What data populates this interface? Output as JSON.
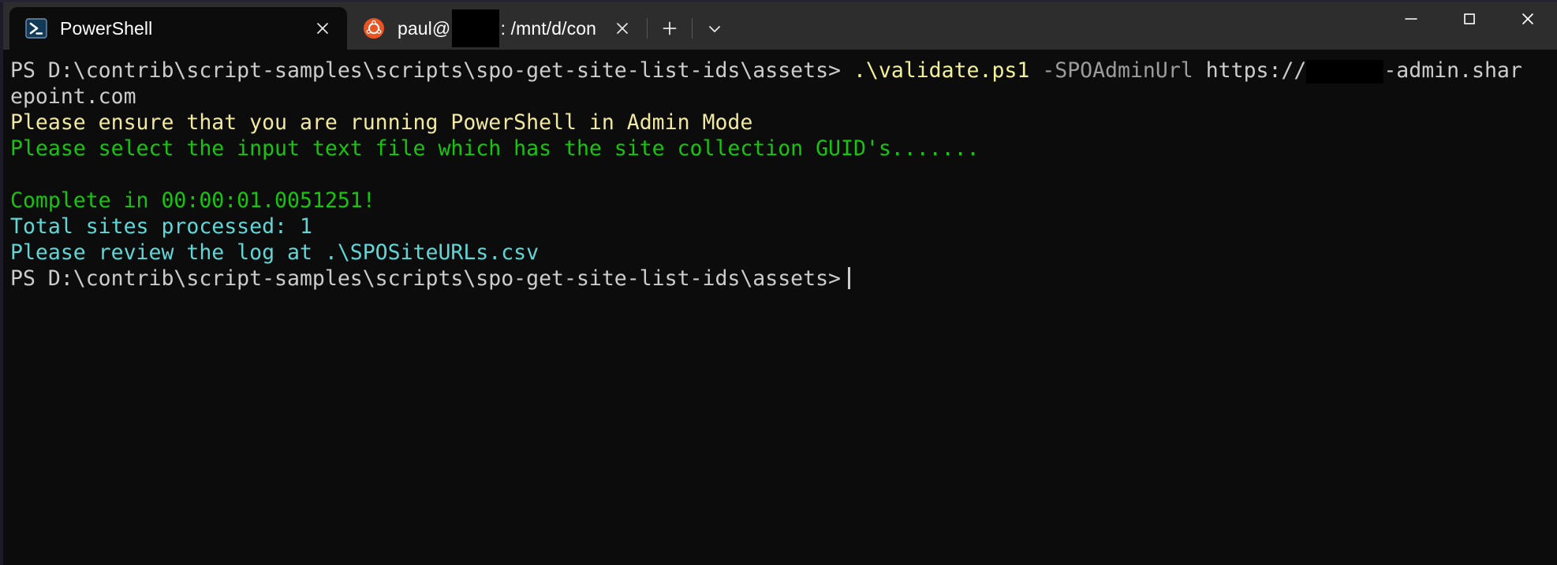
{
  "window": {
    "controls": [
      {
        "name": "minimize",
        "glyph": "minimize-icon"
      },
      {
        "name": "maximize",
        "glyph": "maximize-icon"
      },
      {
        "name": "close",
        "glyph": "close-icon"
      }
    ]
  },
  "tabs": [
    {
      "id": "powershell",
      "title": "PowerShell",
      "icon": "powershell-icon",
      "active": true,
      "close_label": "✕"
    },
    {
      "id": "ubuntu",
      "title_prefix": "paul@",
      "title_suffix": ": /mnt/d/con",
      "redacted": true,
      "icon": "ubuntu-icon",
      "active": false,
      "close_label": "✕"
    }
  ],
  "tabstrip": {
    "new_tab_label": "+",
    "dropdown_label": "⌄"
  },
  "colors": {
    "background": "#0c0c0c",
    "titlebar": "#2d2d2d",
    "default_text": "#cccccc",
    "command_yellow": "#f3f099",
    "parameter_gray": "#9c9c9c",
    "warning_yellow": "#f2e9a0",
    "success_green": "#16c60c",
    "info_cyan": "#61d6d6",
    "powershell_icon": "#01364c",
    "ubuntu_icon": "#e95420"
  },
  "terminal": {
    "lines": [
      {
        "type": "prompt_command",
        "segments": [
          {
            "text": "PS D:\\contrib\\script-samples\\scripts\\spo-get-site-list-ids\\assets> ",
            "color": "default"
          },
          {
            "text": ".\\validate.ps1 ",
            "color": "yellow"
          },
          {
            "text": "-SPOAdminUrl ",
            "color": "param"
          },
          {
            "text": "https://",
            "color": "default"
          },
          {
            "redaction": true,
            "width": 98
          },
          {
            "text": "-admin.shar",
            "color": "default"
          }
        ]
      },
      {
        "type": "wrap",
        "segments": [
          {
            "text": "epoint.com",
            "color": "default"
          }
        ]
      },
      {
        "type": "output",
        "segments": [
          {
            "text": "Please ensure that you are running PowerShell in Admin Mode",
            "color": "warn"
          }
        ]
      },
      {
        "type": "output",
        "segments": [
          {
            "text": "Please select the input text file which has the site collection GUID's.......",
            "color": "green"
          }
        ]
      },
      {
        "type": "blank",
        "segments": [
          {
            "text": "",
            "color": "default"
          }
        ]
      },
      {
        "type": "output",
        "segments": [
          {
            "text": "Complete in 00:00:01.0051251!",
            "color": "green"
          }
        ]
      },
      {
        "type": "output",
        "segments": [
          {
            "text": "Total sites processed: 1",
            "color": "cyan"
          }
        ]
      },
      {
        "type": "output",
        "segments": [
          {
            "text": "Please review the log at .\\SPOSiteURLs.csv",
            "color": "cyan"
          }
        ]
      },
      {
        "type": "prompt_cursor",
        "segments": [
          {
            "text": "PS D:\\contrib\\script-samples\\scripts\\spo-get-site-list-ids\\assets>",
            "color": "default"
          }
        ],
        "cursor": true
      }
    ]
  }
}
